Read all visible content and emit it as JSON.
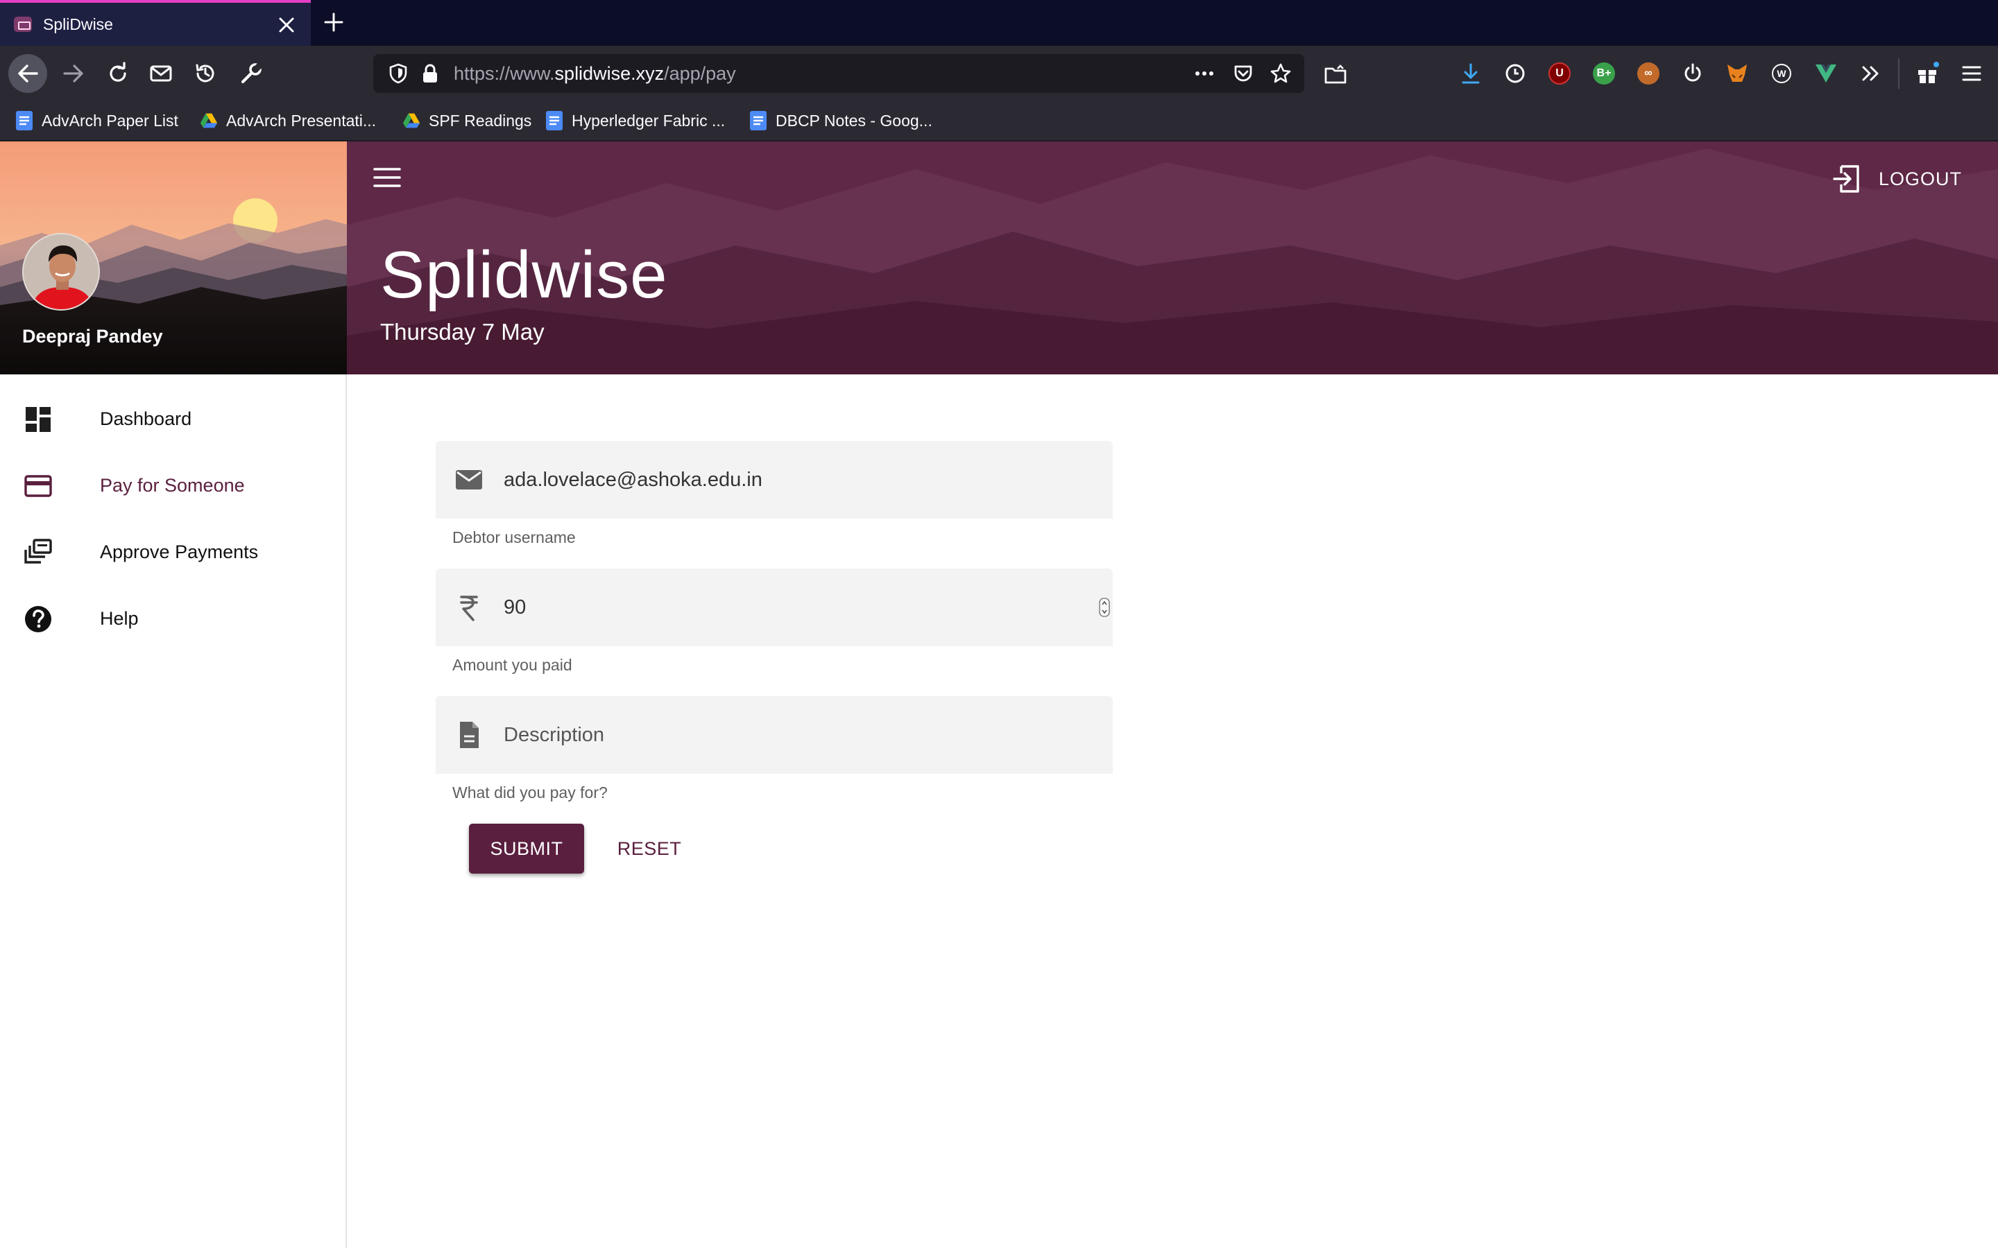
{
  "browser": {
    "tab_title": "SpliDwise",
    "url_prefix": "https://www.",
    "url_domain": "splidwise.xyz",
    "url_path": "/app/pay",
    "bookmarks": [
      {
        "label": "AdvArch Paper List",
        "icon": "google-docs-icon"
      },
      {
        "label": "AdvArch Presentati...",
        "icon": "google-drive-icon"
      },
      {
        "label": "SPF Readings",
        "icon": "google-drive-icon"
      },
      {
        "label": "Hyperledger Fabric ...",
        "icon": "google-docs-icon"
      },
      {
        "label": "DBCP Notes - Goog...",
        "icon": "google-docs-icon"
      }
    ],
    "extensions": [
      "download-icon",
      "clock-icon",
      "ublock-icon",
      "bplus-icon",
      "owl-icon",
      "power-icon",
      "fox-icon",
      "w-icon",
      "vue-icon",
      "overflow-icon",
      "gift-icon",
      "menu-icon"
    ]
  },
  "sidebar": {
    "user_name": "Deepraj Pandey",
    "items": [
      {
        "label": "Dashboard",
        "icon": "dashboard-icon"
      },
      {
        "label": "Pay for Someone",
        "icon": "credit-card-icon",
        "active": true
      },
      {
        "label": "Approve Payments",
        "icon": "library-icon"
      },
      {
        "label": "Help",
        "icon": "help-icon"
      }
    ]
  },
  "header": {
    "title": "Splidwise",
    "date": "Thursday 7 May",
    "logout_label": "LOGOUT"
  },
  "form": {
    "debtor": {
      "value": "ada.lovelace@ashoka.edu.in",
      "helper": "Debtor username"
    },
    "amount": {
      "value": "90",
      "helper": "Amount you paid"
    },
    "description": {
      "value": "",
      "placeholder": "Description",
      "helper": "What did you pay for?"
    },
    "submit_label": "SUBMIT",
    "reset_label": "RESET"
  },
  "colors": {
    "accent": "#5a1f3e",
    "header_bg": "#5a2642",
    "browser_tabbar": "#0c0d26",
    "browser_toolbar": "#2b2a33",
    "tab_highlight": "#e43ec7"
  }
}
